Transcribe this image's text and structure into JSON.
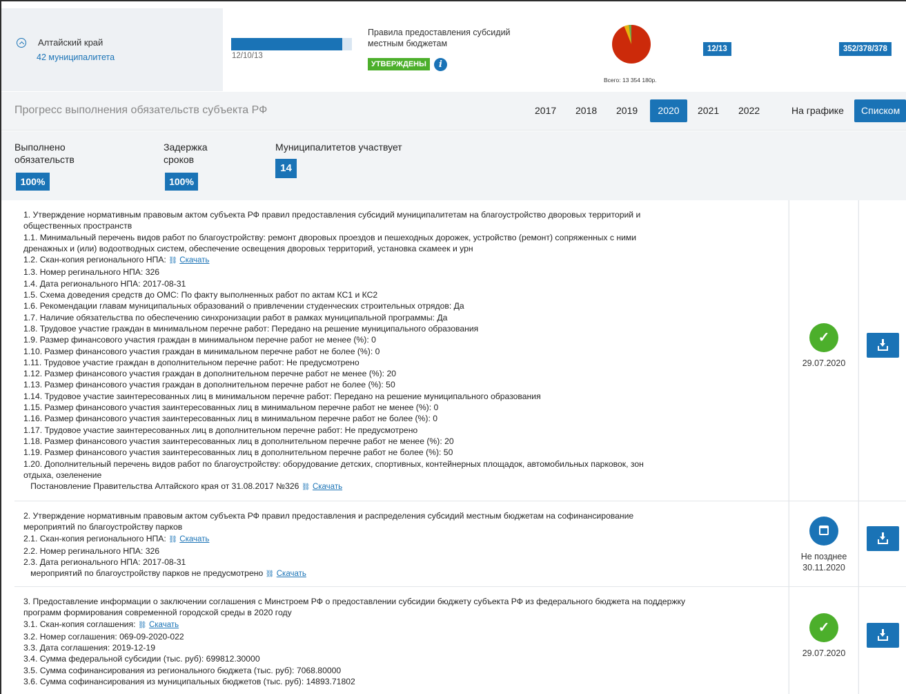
{
  "region": {
    "name": "Алтайский край",
    "municipalities": "42 муниципалитета",
    "progress_text": "12/10/13",
    "progress_fraction": 0.92,
    "rules_text": "Правила предоставления субсидий местным бюджетам",
    "status_badge": "УТВЕРЖДЕНЫ",
    "pie_total": "Всего: 13 354 180р.",
    "count_badge_1": "12/13",
    "count_badge_2": "352/378/378"
  },
  "colors": {
    "accent": "#1a73b6",
    "approved": "#4caf2b",
    "pie_main": "#cc2a0a",
    "pie_secondary": "#e8b40c",
    "pie_tertiary": "#6aa84f"
  },
  "header": {
    "title": "Прогресс выполнения обязательств субъекта РФ",
    "years": [
      "2017",
      "2018",
      "2019",
      "2020",
      "2021",
      "2022"
    ],
    "active_year": "2020",
    "view_chart": "На графике",
    "view_list": "Списком"
  },
  "stats": {
    "done_label": "Выполнено обязательств",
    "done_label_1": "Выполнено",
    "done_label_2": "обязательств",
    "done_value": "100%",
    "delay_label_1": "Задержка",
    "delay_label_2": "сроков",
    "delay_value": "100%",
    "muni_label": "Муниципалитетов участвует",
    "muni_value": "14"
  },
  "common": {
    "download_link": "Скачать"
  },
  "items": [
    {
      "lines": [
        "1. Утверждение нормативным правовым актом субъекта РФ правил предоставления субсидий муниципалитетам на благоустройство дворовых территорий и",
        "общественных пространств",
        "1.1. Минимальный перечень видов работ по благоустройству: ремонт дворовых проездов и пешеходных дорожек, устройство (ремонт) сопряженных с ними",
        "дренажных и (или) водоотводных систем, обеспечение освещения дворовых территорий, установка скамеек и урн",
        "1.2. Скан-копия регионального НПА: ",
        "1.3. Номер регинального НПА: 326",
        "1.4. Дата регионального НПА: 2017-08-31",
        "1.5. Схема доведения средств до ОМС: По факту выполненных работ по актам КС1 и КС2",
        "1.6. Рекомендации главам муниципальных образований о привлечении студенческих строительных отрядов: Да",
        "1.7. Наличие обязательства по обеспечению синхронизации работ в рамках муниципальной программы: Да",
        "1.8. Трудовое участие граждан в минимальном перечне работ: Передано на решение муниципального образования",
        "1.9. Размер финансового участия граждан в минимальном перечне работ не менее (%): 0",
        "1.10. Размер финансового участия граждан в минимальном перечне работ не более (%): 0",
        "1.11. Трудовое участие граждан в дополнительном перечне работ: Не предусмотрено",
        "1.12. Размер финансового участия граждан в дополнительном перечне работ не менее (%): 20",
        "1.13. Размер финансового участия граждан в дополнительном перечне работ не более (%): 50",
        "1.14. Трудовое участие заинтересованных лиц в минимальном перечне работ: Передано на решение муниципального образования",
        "1.15. Размер финансового участия заинтересованных лиц в минимальном перечне работ не менее (%): 0",
        "1.16. Размер финансового участия заинтересованных лиц в минимальном перечне работ не более (%): 0",
        "1.17. Трудовое участие заинтересованных лиц в дополнительном перечне работ: Не предусмотрено",
        "1.18. Размер финансового участия заинтересованных лиц в дополнительном перечне работ не менее (%): 20",
        "1.19. Размер финансового участия заинтересованных лиц в дополнительном перечне работ не более (%): 50",
        "1.20. Дополнительный перечень видов работ по благоустройству: оборудование детских, спортивных, контейнерных площадок, автомобильных парковок, зон",
        "отдыха, озеленение",
        "   Постановление Правительства Алтайского края от 31.08.2017 №326 "
      ],
      "link_lines": [
        4,
        24
      ],
      "status": "ok",
      "date": "29.07.2020"
    },
    {
      "lines": [
        "2. Утверждение нормативным правовым актом субъекта РФ правил предоставления и распределения субсидий местным бюджетам на софинансирование",
        "мероприятий по благоустройству парков",
        "2.1. Скан-копия регионального НПА: ",
        "2.2. Номер регинального НПА: 326",
        "2.3. Дата регионального НПА: 2017-08-31",
        "   мероприятий по благоустройству парков не предусмотрено "
      ],
      "link_lines": [
        2,
        5
      ],
      "status": "calendar",
      "date": "Не позднее 30.11.2020",
      "date_line_1": "Не позднее",
      "date_line_2": "30.11.2020"
    },
    {
      "lines": [
        "3. Предоставление информации о заключении соглашения с Минстроем РФ о предоставлении субсидии бюджету субъекта РФ из федерального бюджета на поддержку",
        "программ формирования современной городской среды в 2020 году",
        "3.1. Скан-копия соглашения: ",
        "3.2. Номер соглашения: 069-09-2020-022",
        "3.3. Дата соглашения: 2019-12-19",
        "3.4. Сумма федеральной субсидии (тыс. руб): 699812.30000",
        "3.5. Сумма софинансирования из регионального бюджета (тыс. руб): 7068.80000",
        "3.6. Сумма софинансирования из муниципальных бюджетов (тыс. руб): 14893.71802"
      ],
      "link_lines": [
        2
      ],
      "status": "ok",
      "date": "29.07.2020"
    }
  ]
}
